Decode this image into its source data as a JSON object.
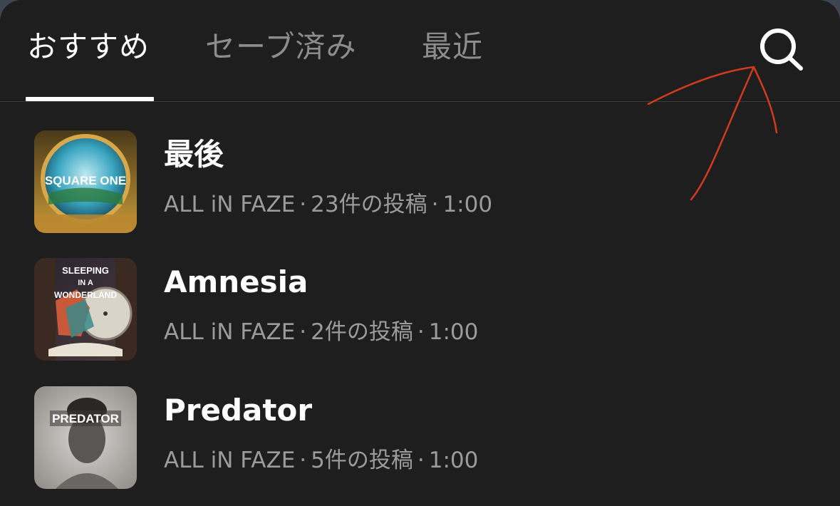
{
  "tabs": {
    "recommended": "おすすめ",
    "saved": "セーブ済み",
    "recent": "最近"
  },
  "search": {
    "icon": "search-icon"
  },
  "songs": [
    {
      "title": "最後",
      "artist": "ALL iN FAZE",
      "posts": "23件の投稿",
      "duration": "1:00",
      "cover_text": "SQUARE ONE"
    },
    {
      "title": "Amnesia",
      "artist": "ALL iN FAZE",
      "posts": "2件の投稿",
      "duration": "1:00",
      "cover_text": [
        "SLEEPING",
        "IN A",
        "WONDERLAND"
      ]
    },
    {
      "title": "Predator",
      "artist": "ALL iN FAZE",
      "posts": "5件の投稿",
      "duration": "1:00",
      "cover_text": "PREDATOR"
    }
  ],
  "meta_separator": "·",
  "colors": {
    "background": "#1e1e1e",
    "text_primary": "#ffffff",
    "text_secondary": "#9b9b9b",
    "tab_inactive": "#8c8c8c",
    "annotation": "#d23a1e"
  }
}
